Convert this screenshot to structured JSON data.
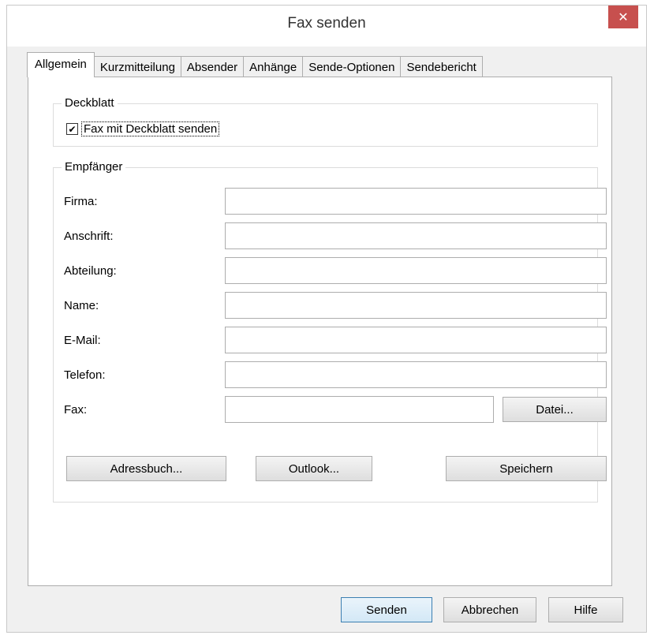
{
  "window": {
    "title": "Fax senden",
    "close": "✕"
  },
  "tabs": [
    {
      "label": "Allgemein"
    },
    {
      "label": "Kurzmitteilung"
    },
    {
      "label": "Absender"
    },
    {
      "label": "Anhänge"
    },
    {
      "label": "Sende-Optionen"
    },
    {
      "label": "Sendebericht"
    }
  ],
  "deckblatt": {
    "legend": "Deckblatt",
    "checkbox_label": "Fax mit Deckblatt senden",
    "checked": true,
    "check_mark": "✔"
  },
  "empfaenger": {
    "legend": "Empfänger",
    "fields": [
      {
        "label": "Firma:",
        "value": ""
      },
      {
        "label": "Anschrift:",
        "value": ""
      },
      {
        "label": "Abteilung:",
        "value": ""
      },
      {
        "label": "Name:",
        "value": ""
      },
      {
        "label": "E-Mail:",
        "value": ""
      },
      {
        "label": "Telefon:",
        "value": ""
      },
      {
        "label": "Fax:",
        "value": ""
      }
    ],
    "datei_button": "Datei...",
    "adressbuch_button": "Adressbuch...",
    "outlook_button": "Outlook...",
    "speichern_button": "Speichern"
  },
  "footer": {
    "senden": "Senden",
    "abbrechen": "Abbrechen",
    "hilfe": "Hilfe"
  },
  "colors": {
    "close_button": "#c7504e",
    "default_button_border": "#3c7fb1"
  }
}
